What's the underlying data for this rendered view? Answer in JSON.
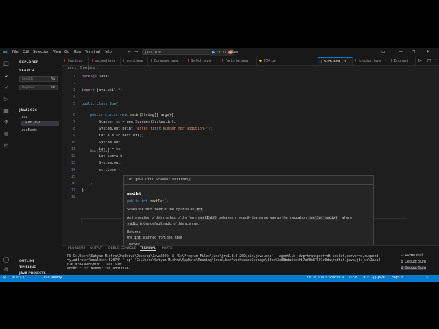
{
  "titlebar": {
    "menu": [
      "File",
      "Edit",
      "Selection",
      "View",
      "Go",
      "Run",
      "Terminal",
      "Help"
    ],
    "search": "Java2026",
    "debug_config": "Sum"
  },
  "sidebar": {
    "explorer_title": "EXPLORER",
    "search_title": "SEARCH",
    "search_placeholder": "Search",
    "replace_placeholder": "Replace",
    "match_case": "Aa",
    "preserve_case": "AB",
    "folder": "JAVA2026",
    "items": [
      "Java",
      "Sum.java",
      "JavaBasic"
    ],
    "outline": "OUTLINE",
    "timeline": "TIMELINE",
    "java_projects": "JAVA PROJECTS"
  },
  "tabs": [
    "first.java",
    "second.java",
    "cond.java",
    "Compare.java",
    "Switch.java",
    "Factorial.java",
    "PS4.py",
    "Sum.java",
    "function.java",
    "Enump.j"
  ],
  "breadcrumb": {
    "folder": "Java",
    "file": "Sum.java",
    "rest": "..."
  },
  "editor": {
    "line_numbers": [
      "1",
      "2",
      "3",
      "4",
      "5",
      "6",
      "7",
      "8",
      "9",
      "10",
      "11",
      "12",
      "13",
      "14",
      "15",
      "16",
      "17",
      "18"
    ],
    "codelens": "Run | Debug",
    "lines": {
      "l1_kw": "package",
      "l1_rest": " Java;",
      "l3_kw": "import",
      "l3_rest": " java.util.*;",
      "l5_kw": "public class",
      "l5_cls": " Sum",
      "l5_rest": "{",
      "l6_kw": "public static void",
      "l6_fn": " main",
      "l6_rest": "(String[] args){",
      "l7": "Scanner sc = new Scanner(System.in);",
      "l8_a": "System.out.print(",
      "l8_str": "\"enter first Number for addition-\"",
      "l8_b": ");",
      "l9": "int a = sc.nextInt();",
      "l10": "System.out.",
      "l11": "int b = sc.",
      "l12": "int sum=a+b",
      "l13": "System.out.",
      "l14": "sc.close();",
      "l16": "}",
      "l17": "}"
    }
  },
  "hover": {
    "signature": "int java.util.Scanner.nextInt()",
    "title": "nextInt",
    "code": "public int nextInt()",
    "p1_a": "Scans the next token of the input as an",
    "p1_code": "int",
    "p1_b": ".",
    "p2_a": "An invocation of this method of the form",
    "p2_code1": "nextInt()",
    "p2_b": "behaves in exactly the same way as the invocation",
    "p2_code2": "nextInt(radix)",
    "p2_c": ", where",
    "p3_code": "radix",
    "p3_b": "is the default radix of this scanner.",
    "returns": "Returns:",
    "returns_a": "the",
    "returns_code": "int",
    "returns_b": "scanned from the input",
    "throws": "Throws:"
  },
  "panel": {
    "tabs": [
      "PROBLEMS",
      "OUTPUT",
      "DEBUG CONSOLE",
      "TERMINAL",
      "PORTS"
    ],
    "terminal_lines": [
      "PS C:\\Users\\Satyam Mishra\\OneDrive\\Desktop\\Java2026>  & 'C:\\Program Files\\Java\\jre1.8.0_202\\bin\\java.exe' '-agentlib:jdwp=transport=dt_socket,server=n,suspend",
      "=y,address=localhost:52074' '-cp' 'C:\\Users\\Satyam Mishra\\AppData\\Roaming\\Code\\User\\workspaceStorage\\80ce63e88bda6eec9b7af0b37691d0da\\redhat.java\\jdt_ws\\Java2",
      "026_0c043605\\bin' 'Java.Sum'",
      "enter first Number for addition-"
    ],
    "terminals": [
      "powershell",
      "Debug: Sum",
      "Debug: Sum"
    ]
  },
  "status": {
    "left": [
      "⊗ 0  ⚠ 0",
      "Java: Ready"
    ],
    "right": [
      "Ln 18, Col 1",
      "Spaces: 4",
      "UTF-8",
      "CRLF",
      "{} Java",
      "Sign in"
    ]
  }
}
